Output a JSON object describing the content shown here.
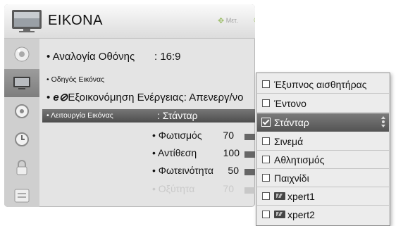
{
  "header": {
    "title": "ΕΙΚΟΝΑ",
    "move_hint": "Μετ.",
    "ok_hint": "OK"
  },
  "sidebar": {
    "active_index": 1,
    "items": [
      {
        "icon": "speaker-icon"
      },
      {
        "icon": "tv-picture-icon"
      },
      {
        "icon": "audio-icon"
      },
      {
        "icon": "clock-icon"
      },
      {
        "icon": "lock-icon"
      },
      {
        "icon": "options-icon"
      }
    ]
  },
  "settings": {
    "aspect_ratio": {
      "label": "Αναλογία Οθόνης",
      "value": ": 16:9"
    },
    "picture_wizard": {
      "label": "Οδηγός Εικόνας"
    },
    "energy_saving": {
      "label": "Εξοικονόμηση Ενέργειας: Απενεργ/νο"
    },
    "picture_mode": {
      "label": "Λειτουργία Εικόνας",
      "value": ": Στάνταρ"
    },
    "sub_settings": [
      {
        "label": "Φωτισμός",
        "value": "70",
        "level": 70
      },
      {
        "label": "Αντίθεση",
        "value": "100",
        "level": 100
      },
      {
        "label": "Φωτεινότητα",
        "value": "50",
        "level": 50
      },
      {
        "label": "Οξύτητα",
        "value": "70",
        "level": 70
      }
    ]
  },
  "popup": {
    "selected_index": 2,
    "options": [
      {
        "label": "Έξυπνος αισθητήρας",
        "checked": false,
        "logo": false
      },
      {
        "label": "Έντονο",
        "checked": false,
        "logo": false
      },
      {
        "label": "Στάνταρ",
        "checked": true,
        "logo": false
      },
      {
        "label": "Σινεμά",
        "checked": false,
        "logo": false
      },
      {
        "label": "Αθλητισμός",
        "checked": false,
        "logo": false
      },
      {
        "label": "Παιχνίδι",
        "checked": false,
        "logo": false
      },
      {
        "label": "xpert1",
        "checked": false,
        "logo": true
      },
      {
        "label": "xpert2",
        "checked": false,
        "logo": true
      }
    ]
  },
  "colors": {
    "highlight_dark": "#4d4d4d",
    "accent_green": "#9dbe6a",
    "bar": "#666666"
  }
}
